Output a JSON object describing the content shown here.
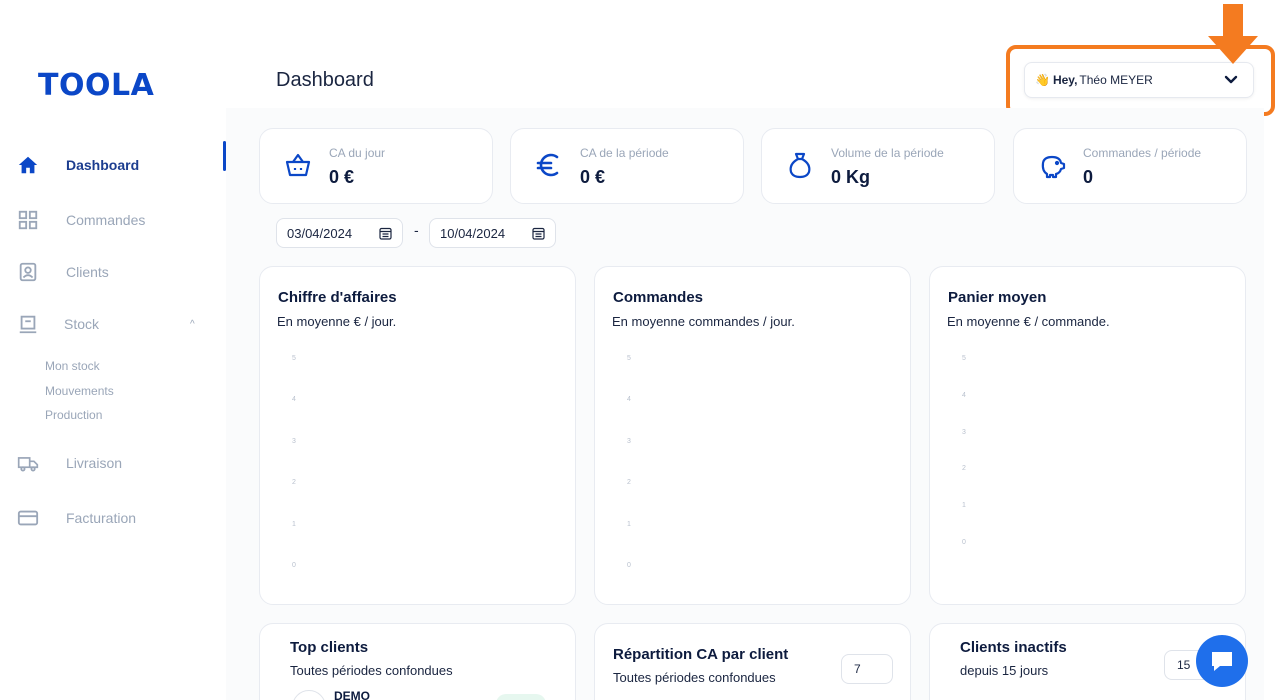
{
  "app": {
    "logo": "TOOLA",
    "page_title": "Dashboard"
  },
  "user": {
    "wave_icon": "👋",
    "greeting": "Hey,",
    "name": "Théo MEYER"
  },
  "sidebar": {
    "items": [
      {
        "label": "Dashboard",
        "icon": "home-icon"
      },
      {
        "label": "Commandes",
        "icon": "grid-icon"
      },
      {
        "label": "Clients",
        "icon": "id-card-icon"
      },
      {
        "label": "Stock",
        "icon": "warehouse-icon"
      },
      {
        "label": "Livraison",
        "icon": "truck-icon"
      },
      {
        "label": "Facturation",
        "icon": "credit-card-icon"
      }
    ],
    "stock_sub": [
      "Mon stock",
      "Mouvements",
      "Production"
    ],
    "stock_chevron": "^"
  },
  "stats": [
    {
      "label": "CA du jour",
      "value": "0 €",
      "icon": "basket-icon"
    },
    {
      "label": "CA de la période",
      "value": "0 €",
      "icon": "euro-icon"
    },
    {
      "label": "Volume de la période",
      "value": "0 Kg",
      "icon": "money-bag-icon"
    },
    {
      "label": "Commandes / période",
      "value": "0",
      "icon": "piggy-bank-icon"
    }
  ],
  "dates": {
    "start": "03/04/2024",
    "separator": "-",
    "end": "10/04/2024"
  },
  "charts": [
    {
      "title": "Chiffre d'affaires",
      "subtitle": "En moyenne € / jour."
    },
    {
      "title": "Commandes",
      "subtitle": "En moyenne commandes / jour."
    },
    {
      "title": "Panier moyen",
      "subtitle": "En moyenne € / commande."
    }
  ],
  "chart_data": [
    {
      "type": "line",
      "title": "Chiffre d'affaires",
      "ylim": [
        0,
        5
      ],
      "y_ticks": [
        "0",
        "1",
        "2",
        "3",
        "4",
        "5"
      ],
      "series": []
    },
    {
      "type": "line",
      "title": "Commandes",
      "ylim": [
        0,
        5
      ],
      "y_ticks": [
        "0",
        "1",
        "2",
        "3",
        "4",
        "5"
      ],
      "series": []
    },
    {
      "type": "line",
      "title": "Panier moyen",
      "ylim": [
        0,
        5
      ],
      "y_ticks": [
        "0",
        "1",
        "2",
        "3",
        "4",
        "5"
      ],
      "series": []
    }
  ],
  "bottom": {
    "top_clients": {
      "title": "Top clients",
      "subtitle": "Toutes périodes confondues",
      "first_row": "DEMO"
    },
    "repartition": {
      "title": "Répartition CA par client",
      "subtitle": "Toutes périodes confondues",
      "count": "7"
    },
    "inactifs": {
      "title": "Clients inactifs",
      "subtitle": "depuis 15 jours",
      "days": "15"
    }
  },
  "colors": {
    "brand": "#0b47c7",
    "highlight": "#f47b20",
    "chat": "#1f6feb"
  }
}
